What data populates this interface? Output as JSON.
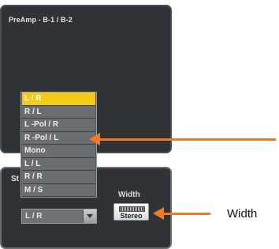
{
  "preamp": {
    "title": "PreAmp - B-1 / B-2"
  },
  "stereo": {
    "title": "St",
    "width_label": "Width",
    "width_button_label": "Stereo",
    "select_value": "L / R"
  },
  "dropdown": {
    "options": [
      "L / R",
      "R / L",
      "L -Pol / R",
      "R -Pol / L",
      "Mono",
      "L / L",
      "R / R",
      "M / S"
    ],
    "selected": "L / R"
  },
  "callout": {
    "label": "Width",
    "color": "#f07a25"
  },
  "colors": {
    "panel": "#2f3336",
    "highlight": "#f6c818",
    "accent": "#f07a25"
  }
}
